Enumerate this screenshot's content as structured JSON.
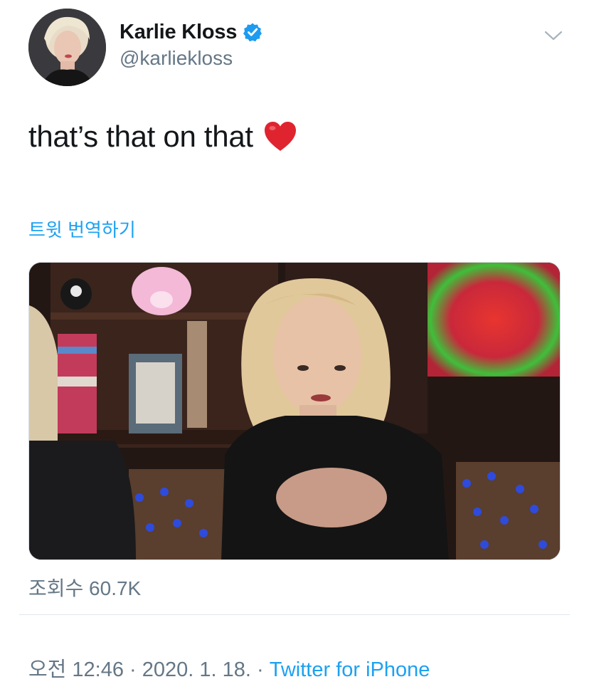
{
  "author": {
    "display_name": "Karlie Kloss",
    "handle": "@karliekloss",
    "verified": true
  },
  "tweet": {
    "text": "that’s that on that",
    "emoji": "red-heart",
    "translate_label": "트윗 번역하기",
    "views_label": "조회수 60.7K"
  },
  "meta": {
    "time": "오전 12:46",
    "separator1": " · ",
    "date": "2020. 1. 18.",
    "separator2": " · ",
    "source": "Twitter for iPhone"
  },
  "colors": {
    "link_blue": "#1da1f2",
    "verified_blue": "#1d9bf0",
    "secondary_text": "#657786",
    "heart_red": "#e0242f"
  },
  "icons": {
    "verified": "verified-badge-icon",
    "menu": "chevron-down-icon",
    "heart": "red-heart-emoji"
  }
}
